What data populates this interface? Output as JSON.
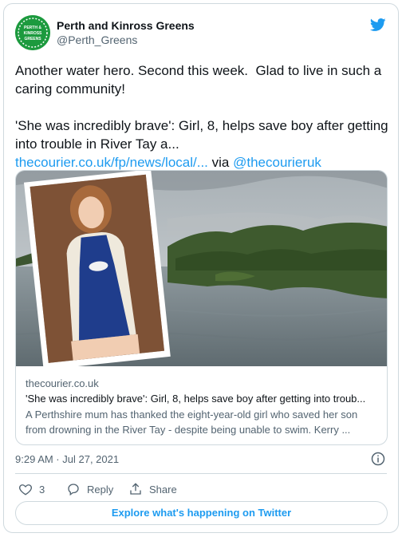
{
  "author": {
    "display_name": "Perth and Kinross Greens",
    "handle": "@Perth_Greens",
    "avatar_text": "PERTH & KINROSS GREENS"
  },
  "tweet": {
    "text_line1": "Another water hero. Second this week.  Glad to live in such a caring community!",
    "text_line2": "'She was incredibly brave': Girl, 8, helps save boy after getting into trouble in River Tay a...",
    "link_url": "thecourier.co.uk/fp/news/local/...",
    "via_text": " via ",
    "via_handle": "@thecourieruk"
  },
  "card": {
    "domain": "thecourier.co.uk",
    "title": "'She was incredibly brave': Girl, 8, helps save boy after getting into troub...",
    "description": "A Perthshire mum has thanked the eight-year-old girl who saved her son from drowning in the River Tay - despite being unable to swim. Kerry ..."
  },
  "timestamp": "9:29 AM · Jul 27, 2021",
  "actions": {
    "like_count": "3",
    "reply_label": "Reply",
    "share_label": "Share"
  },
  "explore_label": "Explore what's happening on Twitter",
  "colors": {
    "accent": "#1d9bf0",
    "brand_green": "#1c9a3e",
    "text_secondary": "#536471",
    "border": "#cfd9de"
  },
  "icons": [
    "twitter-bird-icon",
    "heart-icon",
    "reply-icon",
    "share-icon",
    "info-icon"
  ]
}
